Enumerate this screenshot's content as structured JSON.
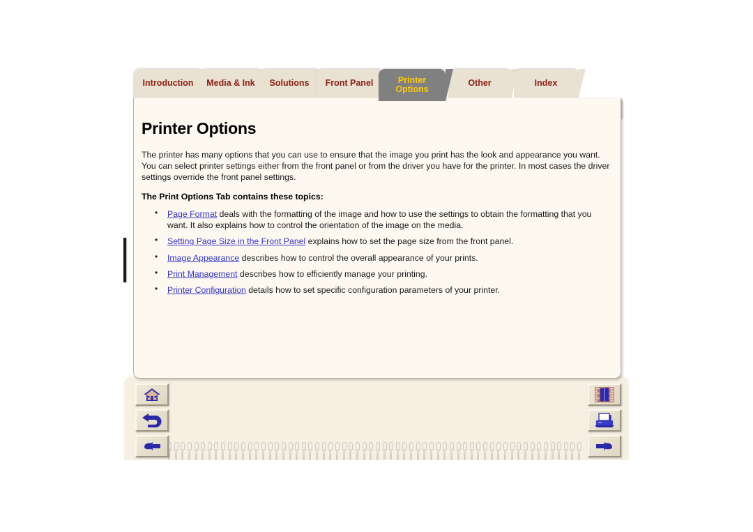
{
  "document": {
    "title": "Printer Options"
  },
  "tabs": [
    {
      "label": "Introduction",
      "active": false
    },
    {
      "label": "Media & Ink",
      "active": false
    },
    {
      "label": "Solutions",
      "active": false
    },
    {
      "label": "Front Panel",
      "active": false
    },
    {
      "label": "Printer Options",
      "active": true
    },
    {
      "label": "Other",
      "active": false
    },
    {
      "label": "Index",
      "active": false
    }
  ],
  "subtabs": [
    {
      "label": "Page Format"
    },
    {
      "label": "Setting Page Size in the Front Panel"
    },
    {
      "label": "Image Appearance"
    },
    {
      "label": "Print Management"
    },
    {
      "label": "Printer Configuration"
    }
  ],
  "main": {
    "heading": "Printer Options",
    "intro": "The printer has many options that you can use to ensure that the image you print has the look and appearance you want. You can select printer settings either from the front panel or from the driver you have for the printer. In most cases the driver settings override the front panel settings.",
    "subheading": "The Print Options Tab contains these topics:",
    "topics": [
      {
        "link": "Page Format",
        "text": " deals with the formatting of the image and how to use the settings to obtain the formatting that you want. It also explains how to control the orientation of the image on the media."
      },
      {
        "link": "Setting Page Size in the Front Panel",
        "text": " explains how to set the page size from the front panel."
      },
      {
        "link": "Image Appearance",
        "text": " describes how to control the overall appearance of your prints."
      },
      {
        "link": "Print Management",
        "text": " describes how to efficiently manage your printing."
      },
      {
        "link": "Printer Configuration",
        "text": " details how to set specific configuration parameters of your printer."
      }
    ]
  },
  "nav": {
    "left": [
      {
        "icon": "home-icon",
        "name": "home-button"
      },
      {
        "icon": "back-arrow-icon",
        "name": "back-button"
      },
      {
        "icon": "hand-left-icon",
        "name": "previous-page-button"
      }
    ],
    "right": [
      {
        "icon": "index-book-icon",
        "name": "index-button"
      },
      {
        "icon": "printer-icon",
        "name": "print-button"
      },
      {
        "icon": "hand-right-icon",
        "name": "next-page-button"
      }
    ]
  },
  "colors": {
    "tab_inactive_bg": "#e9e1d1",
    "tab_inactive_text": "#8c2018",
    "tab_active_bg": "#808080",
    "tab_active_text": "#ffcc00",
    "subtab_bg": "#808080",
    "subtab_text": "#ffffff",
    "page_bg": "#fdf8f0",
    "link": "#3333cc",
    "icon_blue": "#2a2aa8"
  }
}
